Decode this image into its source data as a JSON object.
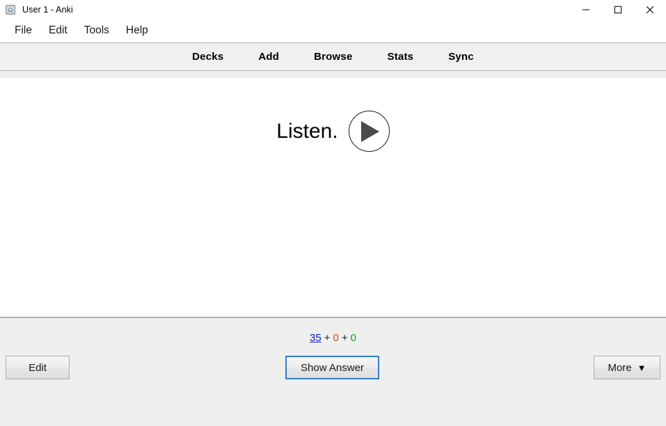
{
  "window": {
    "title": "User 1 - Anki",
    "app_icon": "anki-icon",
    "controls": [
      {
        "name": "minimize",
        "glyph": "minimize-icon"
      },
      {
        "name": "maximize",
        "glyph": "maximize-icon"
      },
      {
        "name": "close",
        "glyph": "close-icon"
      }
    ]
  },
  "menu_bar": {
    "items": [
      {
        "label": "File"
      },
      {
        "label": "Edit"
      },
      {
        "label": "Tools"
      },
      {
        "label": "Help"
      }
    ]
  },
  "toolbar": {
    "links": [
      {
        "label": "Decks"
      },
      {
        "label": "Add"
      },
      {
        "label": "Browse"
      },
      {
        "label": "Stats"
      },
      {
        "label": "Sync"
      }
    ]
  },
  "card": {
    "question_text": "Listen.",
    "play_button_label": "play-audio"
  },
  "bottom": {
    "counts": {
      "new": "35",
      "plus_1": "+",
      "learning": "0",
      "plus_2": "+",
      "review": "0",
      "new_color": "#1414c8",
      "learning_color": "#d2431a",
      "review_color": "#0a9b27"
    },
    "edit_label": "Edit",
    "show_answer_label": "Show Answer",
    "more_label": "More",
    "more_caret": "▼"
  },
  "colors": {
    "toolbar_bg": "#f0f0f0",
    "bottom_bg": "#efefef",
    "card_bg": "#ffffff",
    "focus_border": "#2f7fc7",
    "separator": "#b4b4b4"
  }
}
